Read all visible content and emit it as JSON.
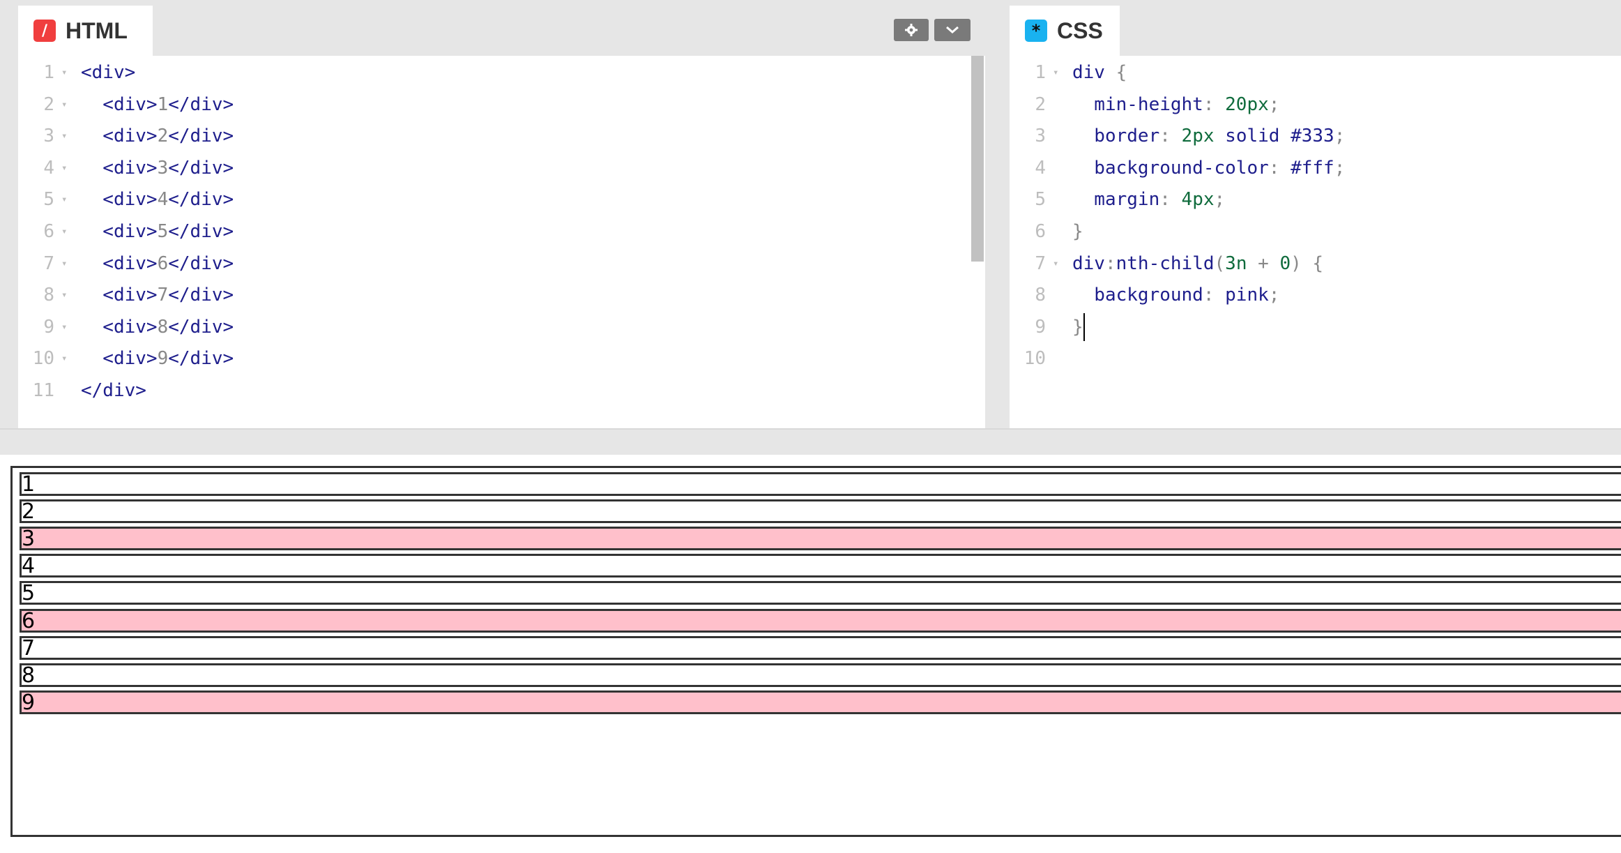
{
  "html_pane": {
    "tab_label": "HTML",
    "icon": "/",
    "lines": [
      {
        "n": "1",
        "fold": true,
        "segments": [
          {
            "t": "<div>",
            "c": "tag"
          }
        ]
      },
      {
        "n": "2",
        "fold": true,
        "segments": [
          {
            "t": "  <div>",
            "c": "tag"
          },
          {
            "t": "1",
            "c": "text"
          },
          {
            "t": "</div>",
            "c": "tag"
          }
        ]
      },
      {
        "n": "3",
        "fold": true,
        "segments": [
          {
            "t": "  <div>",
            "c": "tag"
          },
          {
            "t": "2",
            "c": "text"
          },
          {
            "t": "</div>",
            "c": "tag"
          }
        ]
      },
      {
        "n": "4",
        "fold": true,
        "segments": [
          {
            "t": "  <div>",
            "c": "tag"
          },
          {
            "t": "3",
            "c": "text"
          },
          {
            "t": "</div>",
            "c": "tag"
          }
        ]
      },
      {
        "n": "5",
        "fold": true,
        "segments": [
          {
            "t": "  <div>",
            "c": "tag"
          },
          {
            "t": "4",
            "c": "text"
          },
          {
            "t": "</div>",
            "c": "tag"
          }
        ]
      },
      {
        "n": "6",
        "fold": true,
        "segments": [
          {
            "t": "  <div>",
            "c": "tag"
          },
          {
            "t": "5",
            "c": "text"
          },
          {
            "t": "</div>",
            "c": "tag"
          }
        ]
      },
      {
        "n": "7",
        "fold": true,
        "segments": [
          {
            "t": "  <div>",
            "c": "tag"
          },
          {
            "t": "6",
            "c": "text"
          },
          {
            "t": "</div>",
            "c": "tag"
          }
        ]
      },
      {
        "n": "8",
        "fold": true,
        "segments": [
          {
            "t": "  <div>",
            "c": "tag"
          },
          {
            "t": "7",
            "c": "text"
          },
          {
            "t": "</div>",
            "c": "tag"
          }
        ]
      },
      {
        "n": "9",
        "fold": true,
        "segments": [
          {
            "t": "  <div>",
            "c": "tag"
          },
          {
            "t": "8",
            "c": "text"
          },
          {
            "t": "</div>",
            "c": "tag"
          }
        ]
      },
      {
        "n": "10",
        "fold": true,
        "segments": [
          {
            "t": "  <div>",
            "c": "tag"
          },
          {
            "t": "9",
            "c": "text"
          },
          {
            "t": "</div>",
            "c": "tag"
          }
        ]
      },
      {
        "n": "11",
        "fold": false,
        "segments": [
          {
            "t": "</div>",
            "c": "tag"
          }
        ]
      }
    ]
  },
  "css_pane": {
    "tab_label": "CSS",
    "icon": "*",
    "lines": [
      {
        "n": "1",
        "fold": true,
        "segments": [
          {
            "t": "div ",
            "c": "tag"
          },
          {
            "t": "{",
            "c": "punc"
          }
        ]
      },
      {
        "n": "2",
        "fold": false,
        "segments": [
          {
            "t": "  min-height",
            "c": "prop"
          },
          {
            "t": ": ",
            "c": "punc"
          },
          {
            "t": "20px",
            "c": "val"
          },
          {
            "t": ";",
            "c": "punc"
          }
        ]
      },
      {
        "n": "3",
        "fold": false,
        "segments": [
          {
            "t": "  border",
            "c": "prop"
          },
          {
            "t": ": ",
            "c": "punc"
          },
          {
            "t": "2px ",
            "c": "val"
          },
          {
            "t": "solid ",
            "c": "prop"
          },
          {
            "t": "#333",
            "c": "prop"
          },
          {
            "t": ";",
            "c": "punc"
          }
        ]
      },
      {
        "n": "4",
        "fold": false,
        "segments": [
          {
            "t": "  background-color",
            "c": "prop"
          },
          {
            "t": ": ",
            "c": "punc"
          },
          {
            "t": "#fff",
            "c": "prop"
          },
          {
            "t": ";",
            "c": "punc"
          }
        ]
      },
      {
        "n": "5",
        "fold": false,
        "segments": [
          {
            "t": "  margin",
            "c": "prop"
          },
          {
            "t": ": ",
            "c": "punc"
          },
          {
            "t": "4px",
            "c": "val"
          },
          {
            "t": ";",
            "c": "punc"
          }
        ]
      },
      {
        "n": "6",
        "fold": false,
        "segments": [
          {
            "t": "}",
            "c": "punc"
          }
        ]
      },
      {
        "n": "7",
        "fold": true,
        "segments": [
          {
            "t": "div",
            "c": "tag"
          },
          {
            "t": ":",
            "c": "punc"
          },
          {
            "t": "nth-child",
            "c": "tag"
          },
          {
            "t": "(",
            "c": "punc"
          },
          {
            "t": "3n",
            "c": "val"
          },
          {
            "t": " + ",
            "c": "punc"
          },
          {
            "t": "0",
            "c": "val"
          },
          {
            "t": ") ",
            "c": "punc"
          },
          {
            "t": "{",
            "c": "punc"
          }
        ]
      },
      {
        "n": "8",
        "fold": false,
        "segments": [
          {
            "t": "  background",
            "c": "prop"
          },
          {
            "t": ": ",
            "c": "punc"
          },
          {
            "t": "pink",
            "c": "prop"
          },
          {
            "t": ";",
            "c": "punc"
          }
        ]
      },
      {
        "n": "9",
        "fold": false,
        "segments": [
          {
            "t": "}",
            "c": "punc"
          }
        ]
      },
      {
        "n": "10",
        "fold": false,
        "segments": []
      }
    ]
  },
  "result": {
    "rows": [
      {
        "label": "1",
        "pink": false
      },
      {
        "label": "2",
        "pink": false
      },
      {
        "label": "3",
        "pink": true
      },
      {
        "label": "4",
        "pink": false
      },
      {
        "label": "5",
        "pink": false
      },
      {
        "label": "6",
        "pink": true
      },
      {
        "label": "7",
        "pink": false
      },
      {
        "label": "8",
        "pink": false
      },
      {
        "label": "9",
        "pink": true
      }
    ]
  },
  "colors": {
    "pink": "#ffc0cb",
    "html_icon": "#f03e3e",
    "css_icon": "#19b2f0"
  },
  "icons": {
    "html_tab": "html-icon",
    "css_tab": "css-icon",
    "settings": "gear-icon",
    "collapse": "chevron-down-icon"
  }
}
